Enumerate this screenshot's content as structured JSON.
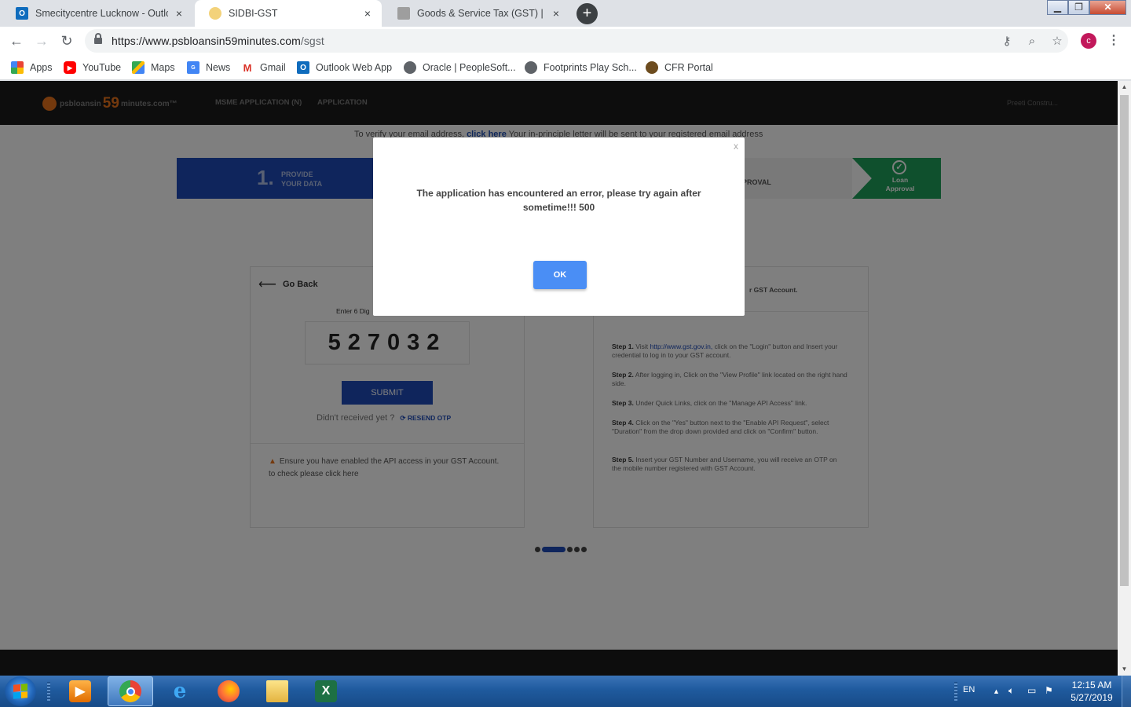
{
  "browser": {
    "tabs": [
      {
        "label": "Smecitycentre Lucknow - Outlook",
        "icon": "outlook-icon",
        "active": false
      },
      {
        "label": "SIDBI-GST",
        "icon": "sidbi-icon",
        "active": true
      },
      {
        "label": "Goods & Service Tax (GST) | User",
        "icon": "gst-emblem-icon",
        "active": false
      }
    ],
    "close_glyph": "×",
    "new_tab_glyph": "+",
    "window_controls": {
      "minimize": "▁",
      "maximize": "❐",
      "close": "✕"
    },
    "url_host": "https://www.psbloansin59minutes.com",
    "url_path": "/sgst",
    "profile_initial": "c",
    "profile_color": "#c2185b",
    "bookmarks": [
      {
        "label": "Apps",
        "icon": "apps-grid-icon"
      },
      {
        "label": "YouTube",
        "icon": "youtube-icon"
      },
      {
        "label": "Maps",
        "icon": "maps-icon"
      },
      {
        "label": "News",
        "icon": "news-icon"
      },
      {
        "label": "Gmail",
        "icon": "gmail-icon"
      },
      {
        "label": "Outlook Web App",
        "icon": "outlook-icon"
      },
      {
        "label": "Oracle | PeopleSoft...",
        "icon": "globe-icon"
      },
      {
        "label": "Footprints Play Sch...",
        "icon": "globe-icon"
      },
      {
        "label": "CFR Portal",
        "icon": "cfr-icon"
      }
    ]
  },
  "site": {
    "logo": {
      "part1": "psbloansin",
      "part2": "59",
      "part3": "minutes.com™"
    },
    "nav": [
      "MSME APPLICATION (N)",
      "APPLICATION"
    ],
    "user_menu": "Preeti Constru...",
    "verify_prefix": "To verify your email address,",
    "verify_link": "click here",
    "verify_suffix": "Your in-principle letter will be sent to your registered email address",
    "steps": {
      "step1_num": "1.",
      "step1_line1": "PROVIDE",
      "step1_line2": "YOUR DATA",
      "step2_label": "PROVAL",
      "step3_line1": "Loan",
      "step3_line2": "Approval",
      "brand_blue": "#1e4bb8",
      "brand_green": "#1fa15a"
    },
    "otp_card": {
      "go_back": "Go Back",
      "otp_label": "Enter 6 Dig",
      "otp_value": "527032",
      "submit": "SUBMIT",
      "resend_prompt": "Didn't received yet ?",
      "resend_link": "RESEND OTP",
      "api_note": "Ensure you have enabled the API access in your GST Account. to check please click here"
    },
    "help_card": {
      "title": "r GST Account.",
      "steps": [
        {
          "label": "Step 1.",
          "before": "Visit",
          "link": "http://www.gst.gov.in,",
          "text": "click on the \"Login\" button and Insert your credential to log in to your GST account."
        },
        {
          "label": "Step 2.",
          "before": "",
          "link": "",
          "text": "After logging in, Click on the \"View Profile\" link located on the right hand side."
        },
        {
          "label": "Step 3.",
          "before": "",
          "link": "",
          "text": "Under Quick Links, click on the \"Manage API Access\" link."
        },
        {
          "label": "Step 4.",
          "before": "",
          "link": "",
          "text": "Click on the \"Yes\" button next to the \"Enable API Request\", select \"Duration\" from the drop down provided and click on \"Confirm\" button."
        },
        {
          "label": "Step 5.",
          "before": "",
          "link": "",
          "text": "Insert your GST Number and Username, you will receive an OTP on the mobile number registered with GST Account."
        }
      ]
    }
  },
  "modal": {
    "close": "x",
    "message": "The application has encountered an error, please try again after sometime!!! 500",
    "ok": "OK",
    "ok_color": "#4a8ef5"
  },
  "taskbar": {
    "apps": [
      {
        "name": "media-player-icon"
      },
      {
        "name": "chrome-icon",
        "active": true
      },
      {
        "name": "internet-explorer-icon"
      },
      {
        "name": "firefox-icon"
      },
      {
        "name": "file-explorer-icon"
      },
      {
        "name": "excel-icon"
      }
    ],
    "language": "EN",
    "time": "12:15 AM",
    "date": "5/27/2019"
  }
}
